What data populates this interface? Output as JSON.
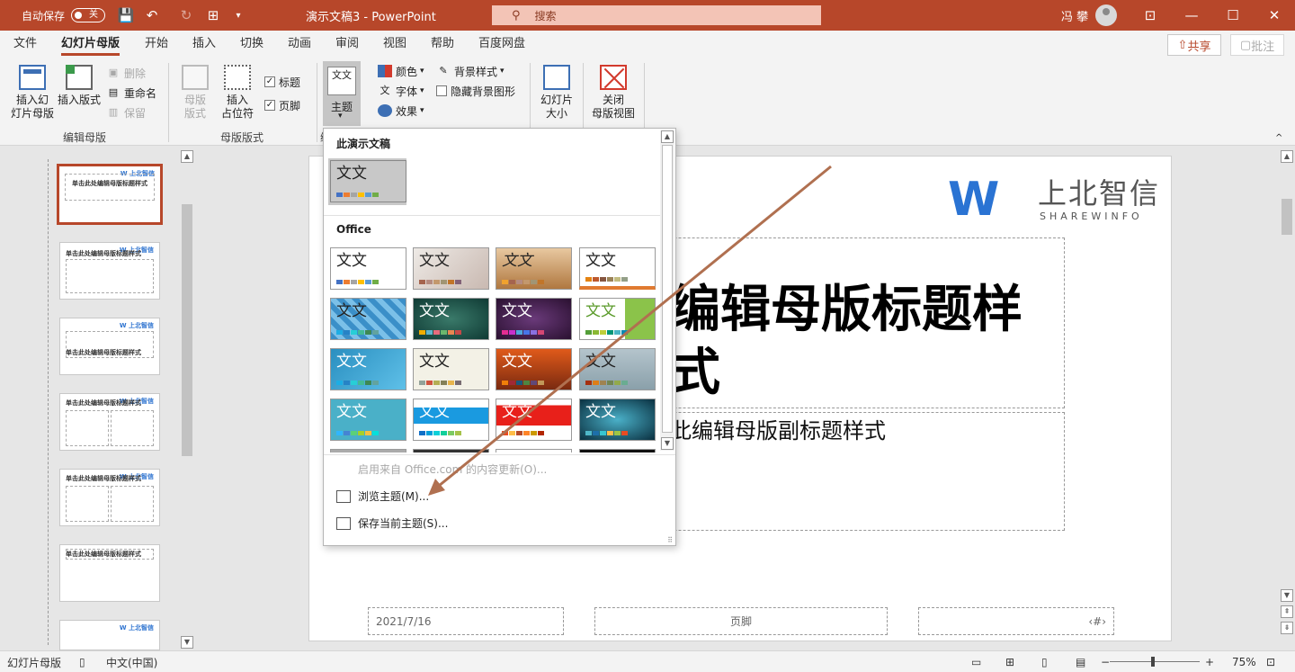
{
  "titlebar": {
    "autosave_label": "自动保存",
    "autosave_state": "关",
    "doc_title": "演示文稿3  -  PowerPoint",
    "search_placeholder": "搜索",
    "username": "冯 攀"
  },
  "tabs": [
    "文件",
    "幻灯片母版",
    "开始",
    "插入",
    "切换",
    "动画",
    "审阅",
    "视图",
    "帮助",
    "百度网盘"
  ],
  "active_tab": "幻灯片母版",
  "share_label": "共享",
  "comment_label": "批注",
  "ribbon": {
    "insert_master": "插入幻\n灯片母版",
    "insert_layout": "插入版式",
    "delete": "删除",
    "rename": "重命名",
    "preserve": "保留",
    "group_edit_master": "编辑母版",
    "master_layout": "母版\n版式",
    "insert_placeholder": "插入\n占位符",
    "chk_title": "标题",
    "chk_footer": "页脚",
    "group_master_layout": "母版版式",
    "themes": "主题",
    "colors": "颜色",
    "fonts": "字体",
    "effects": "效果",
    "background_styles": "背景样式",
    "hide_bg_graphics": "隐藏背景图形",
    "group_edit_theme_partial": "编",
    "slide_size": "幻灯片\n大小",
    "close_master": "关闭\n母版视图",
    "theme_icon_text": "文文"
  },
  "dropdown": {
    "section_this": "此演示文稿",
    "section_office": "Office",
    "tile_text": "文文",
    "enable_updates": "启用来自 Office.com 的内容更新(O)...",
    "browse_themes": "浏览主题(M)...",
    "save_theme": "保存当前主题(S)..."
  },
  "thumbnails": {
    "master_title": "单击此处编辑母版标题样式",
    "layout_title": "单击此处编辑母版标题样式",
    "logo": "W 上北智信"
  },
  "slide": {
    "logo_letter": "W",
    "logo_cn": "上北智信",
    "logo_en": "SHAREWINFO",
    "title": "编辑母版标题样式",
    "sub": "此编辑母版副标题样式",
    "footer_date": "2021/7/16",
    "footer_text": "页脚",
    "footer_num": "‹#›"
  },
  "statusbar": {
    "view": "幻灯片母版",
    "lang": "中文(中国)",
    "zoom": "75%"
  },
  "colors": {
    "accent": "#b7472a",
    "logo_blue": "#2a73d3",
    "arrow": "#b07050"
  }
}
